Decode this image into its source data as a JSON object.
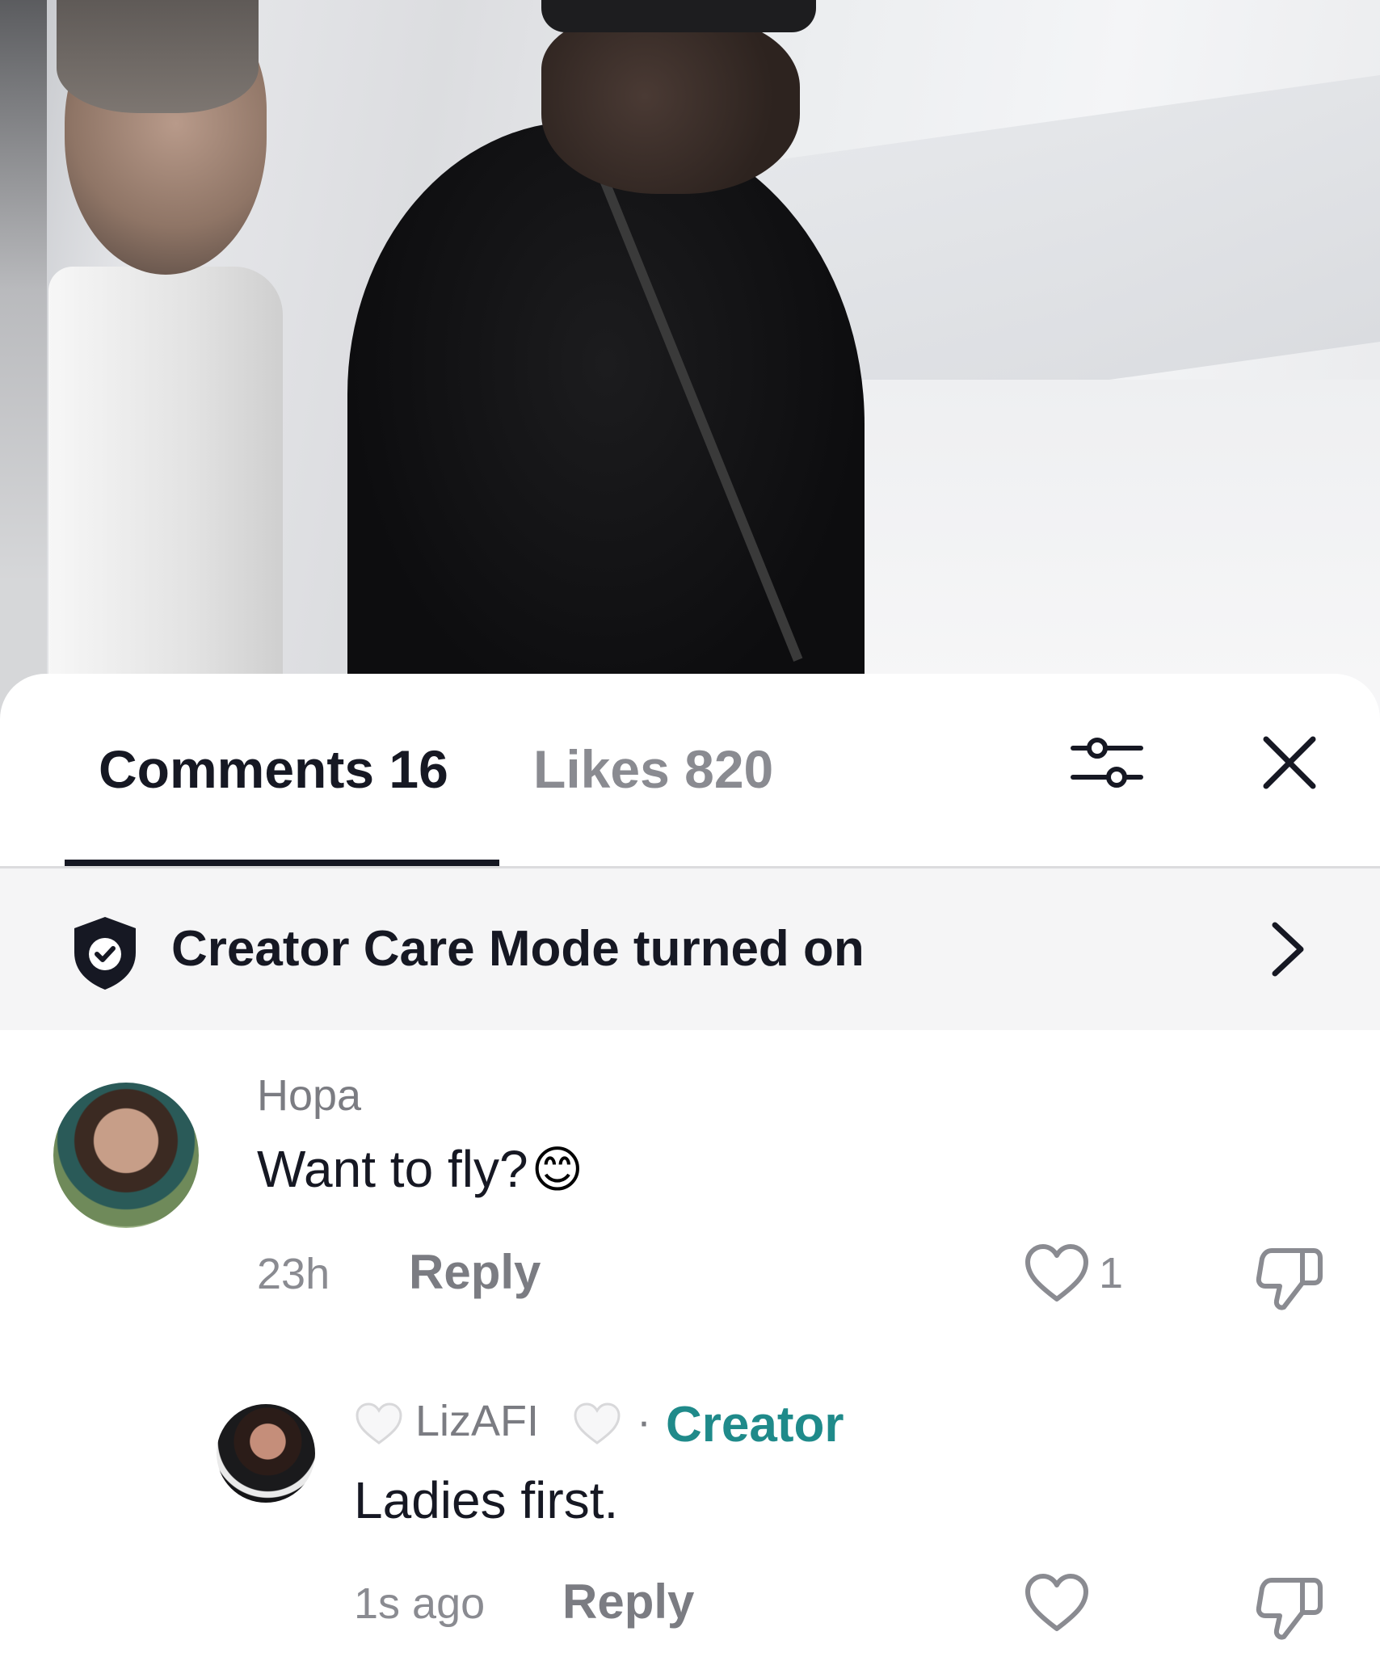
{
  "tabs": {
    "comments_label": "Comments 16",
    "likes_label": "Likes 820"
  },
  "care_banner": {
    "text": "Creator Care Mode turned on"
  },
  "comments": [
    {
      "username": "Нора",
      "text": "Want to fly?",
      "emoji": "😊",
      "time": "23h",
      "reply_label": "Reply",
      "like_count": "1"
    }
  ],
  "replies": [
    {
      "username": "LizAFI",
      "separator": "·",
      "badge": "Creator",
      "text": "Ladies first.",
      "time": "1s ago",
      "reply_label": "Reply"
    }
  ],
  "colors": {
    "creator_badge": "#1f8a8a",
    "text_primary": "#161823",
    "text_secondary": "#8a8b91"
  },
  "icons": [
    "filter-icon",
    "close-icon",
    "shield-check-icon",
    "chevron-right-icon",
    "heart-icon",
    "thumbs-down-icon",
    "white-heart-icon"
  ]
}
